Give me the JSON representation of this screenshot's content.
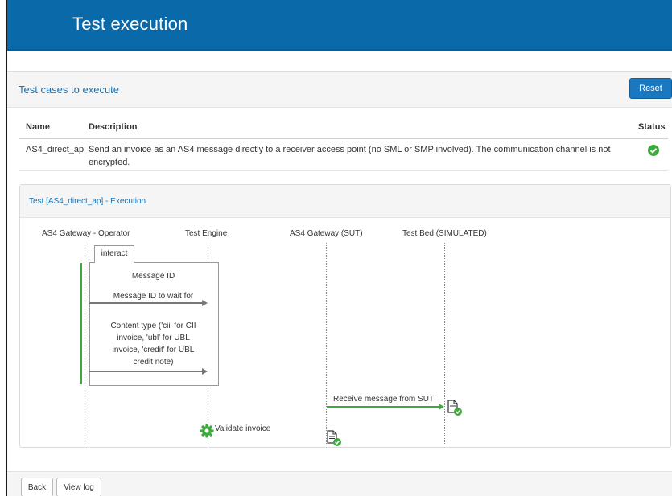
{
  "header": {
    "title": "Test execution"
  },
  "panel": {
    "title": "Test cases to execute",
    "reset_label": "Reset"
  },
  "table": {
    "columns": {
      "name": "Name",
      "description": "Description",
      "status": "Status"
    },
    "rows": [
      {
        "name": "AS4_direct_ap",
        "description_line1": "Send an invoice as an AS4 message directly to a receiver access point (no SML or SMP involved). The communication channel is not",
        "description_line2": "encrypted.",
        "status_icon": "check-circle-icon",
        "status_color": "#3cab3c"
      }
    ]
  },
  "execution": {
    "title": "Test [AS4_direct_ap] - Execution",
    "actors": [
      "AS4 Gateway - Operator",
      "Test Engine",
      "AS4 Gateway (SUT)",
      "Test Bed (SIMULATED)"
    ],
    "interact_label": "interact",
    "messages": {
      "message_id": "Message ID",
      "message_id_wait": "Message ID to wait for",
      "content_type_1": "Content type ('cii' for CII",
      "content_type_2": "invoice, 'ubl' for UBL",
      "content_type_3": "invoice, 'credit' for UBL",
      "content_type_4": "credit note)",
      "receive": "Receive message from SUT",
      "validate": "Validate invoice"
    }
  },
  "footer": {
    "back_label": "Back",
    "view_log_label": "View log"
  },
  "colors": {
    "brand": "#0a69a8",
    "success": "#3cab3c",
    "link": "#1a74b5"
  }
}
